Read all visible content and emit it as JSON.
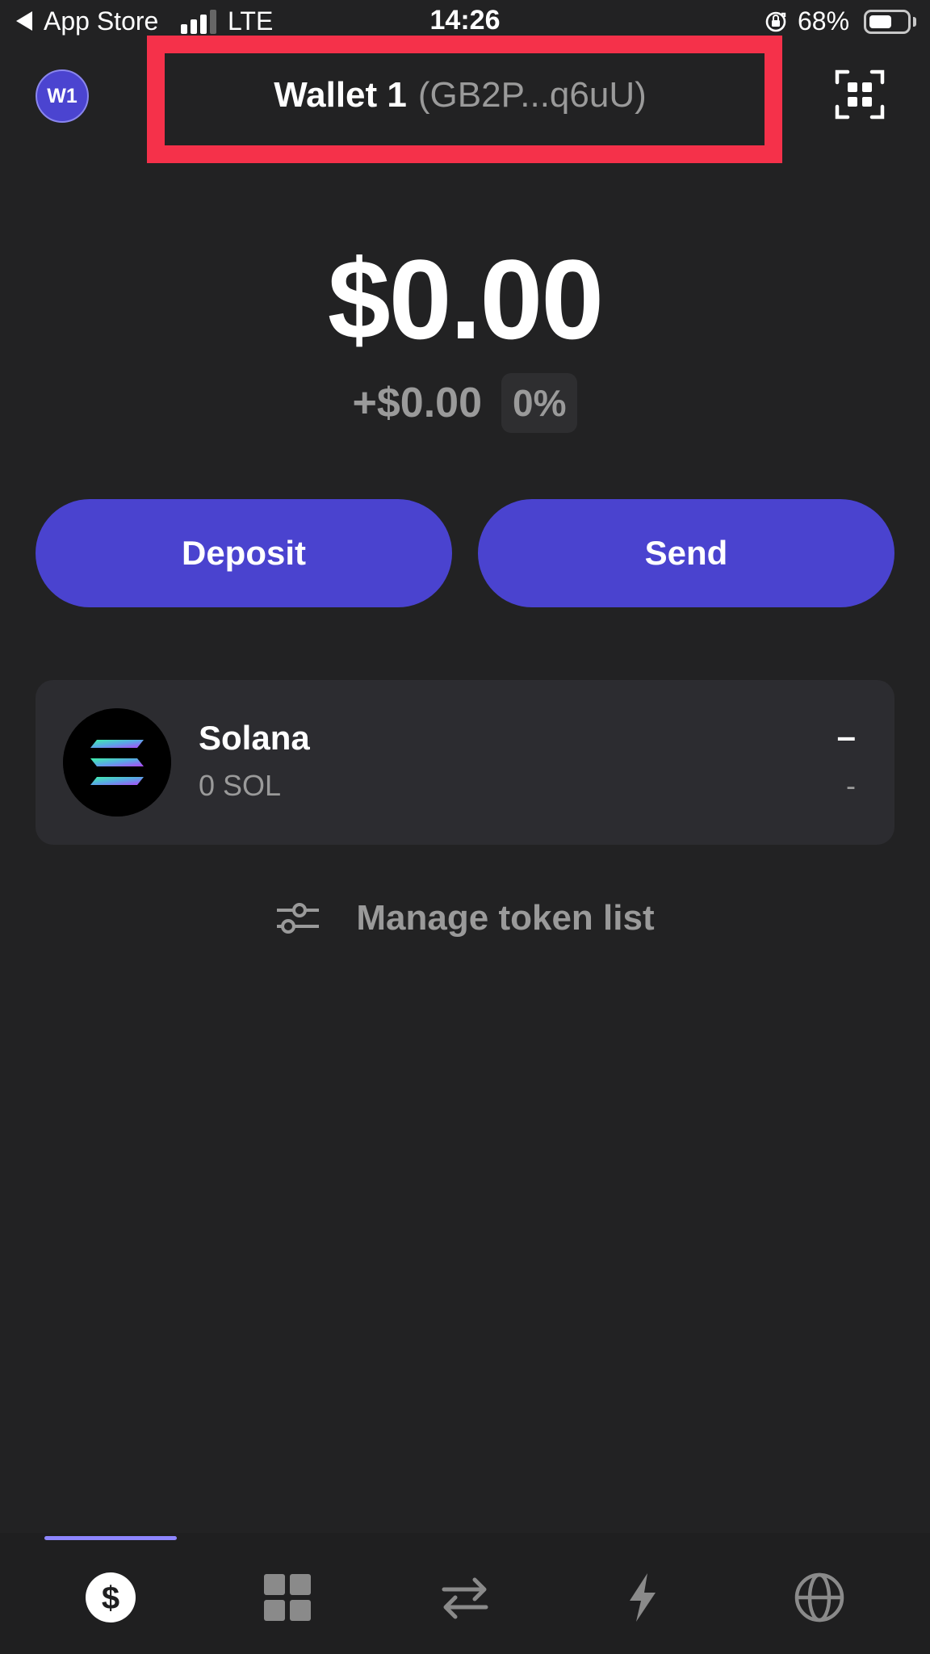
{
  "status_bar": {
    "back_app": "App Store",
    "network": "LTE",
    "time": "14:26",
    "battery_percent": "68%",
    "battery_level": 0.68
  },
  "header": {
    "avatar_label": "W1",
    "wallet_name": "Wallet 1",
    "wallet_address": "(GB2P...q6uU)",
    "scan_icon": "qr-scan-icon"
  },
  "balance": {
    "total": "$0.00",
    "change_amount": "+$0.00",
    "change_percent": "0%"
  },
  "actions": {
    "deposit_label": "Deposit",
    "send_label": "Send"
  },
  "tokens": [
    {
      "name": "Solana",
      "amount": "0 SOL",
      "value": "–",
      "change": "-",
      "icon": "solana-logo-icon"
    }
  ],
  "manage": {
    "label": "Manage token list",
    "icon": "sliders-icon"
  },
  "bottom_nav": {
    "items": [
      {
        "icon": "dollar-icon",
        "active": true
      },
      {
        "icon": "collectibles-grid-icon",
        "active": false
      },
      {
        "icon": "swap-arrows-icon",
        "active": false
      },
      {
        "icon": "lightning-icon",
        "active": false
      },
      {
        "icon": "globe-icon",
        "active": false
      }
    ]
  },
  "colors": {
    "background": "#222223",
    "accent": "#4a43cf",
    "highlight": "#f5314a",
    "card": "#2c2c30",
    "muted_text": "#9a9a9a"
  }
}
